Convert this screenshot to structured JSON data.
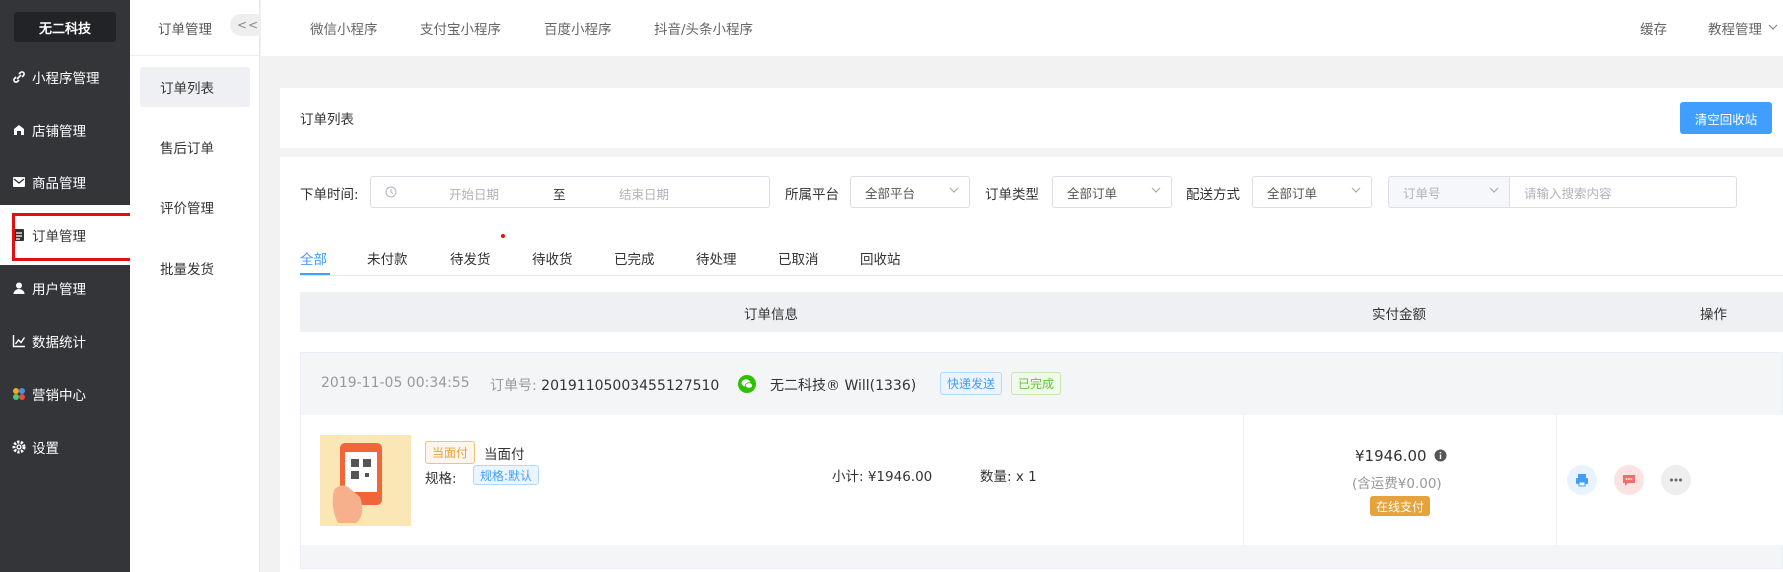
{
  "nav": {
    "logo": "无二科技",
    "items": [
      {
        "label": "小程序管理",
        "icon": "link-icon"
      },
      {
        "label": "店铺管理",
        "icon": "store-icon"
      },
      {
        "label": "商品管理",
        "icon": "mail-box-icon"
      },
      {
        "label": "订单管理",
        "icon": "list-icon"
      },
      {
        "label": "用户管理",
        "icon": "user-icon"
      },
      {
        "label": "数据统计",
        "icon": "line-chart-icon"
      },
      {
        "label": "营销中心",
        "icon": "puzzle-icon"
      },
      {
        "label": "设置",
        "icon": "gear-icon"
      }
    ],
    "active_index": 3
  },
  "subnav": {
    "title": "订单管理",
    "collapse": "<<",
    "items": [
      "订单列表",
      "售后订单",
      "评价管理",
      "批量发货"
    ],
    "active_index": 0
  },
  "topbar": {
    "tabs": [
      "微信小程序",
      "支付宝小程序",
      "百度小程序",
      "抖音/头条小程序"
    ],
    "right": {
      "cache": "缓存",
      "tutorial": "教程管理"
    }
  },
  "page": {
    "title": "订单列表",
    "clear_button": "清空回收站"
  },
  "filters": {
    "order_time_label": "下单时间:",
    "start_placeholder": "开始日期",
    "range_sep": "至",
    "end_placeholder": "结束日期",
    "platform_label": "所属平台",
    "platform_value": "全部平台",
    "type_label": "订单类型",
    "type_value": "全部订单",
    "delivery_label": "配送方式",
    "delivery_value": "全部订单",
    "search_field": "订单号",
    "search_placeholder": "请输入搜索内容"
  },
  "status_tabs": [
    "全部",
    "未付款",
    "待发货",
    "待收货",
    "已完成",
    "待处理",
    "已取消",
    "回收站"
  ],
  "table": {
    "headers": {
      "info": "订单信息",
      "amount": "实付金额",
      "ops": "操作"
    }
  },
  "order": {
    "time": "2019-11-05 00:34:55",
    "no_label": "订单号:",
    "no": "20191105003455127510",
    "buyer": "无二科技® Will(1336)",
    "tag_delivery": "快递发送",
    "tag_status": "已完成",
    "product": {
      "badge": "当面付",
      "name": "当面付",
      "spec_label": "规格:",
      "spec_value": "规格:默认",
      "subtotal": "小计: ¥1946.00",
      "quantity": "数量: x 1"
    },
    "pay": {
      "amount": "¥1946.00",
      "shipping": "(含运费¥0.00)",
      "method": "在线支付"
    }
  },
  "colors": {
    "accent": "#409eff",
    "nav_bg": "#333539",
    "highlight": "#e01010"
  }
}
